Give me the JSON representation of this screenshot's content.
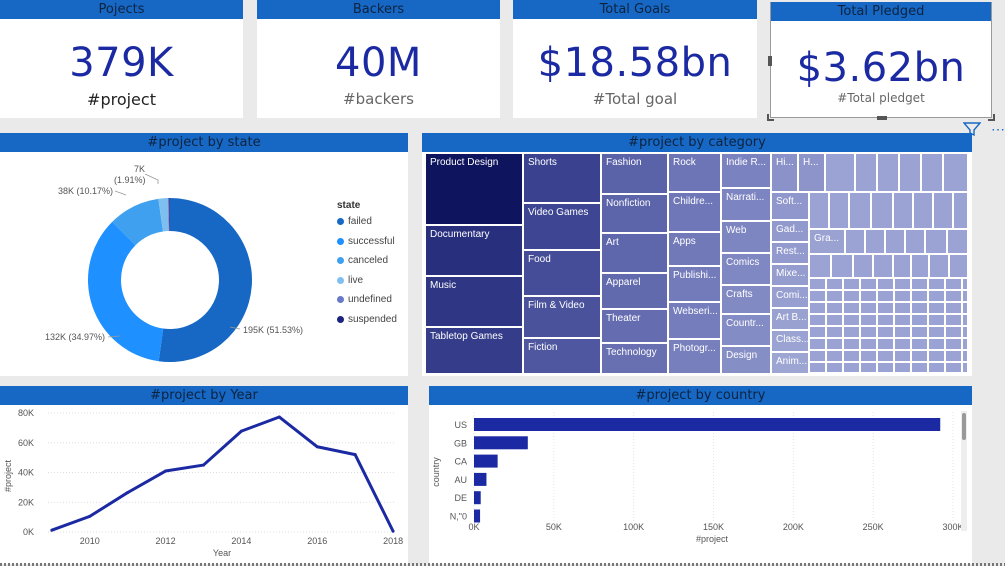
{
  "kpis": [
    {
      "header": "Pojects",
      "value": "379K",
      "sub": "#project"
    },
    {
      "header": "Backers",
      "value": "40M",
      "sub": "#backers"
    },
    {
      "header": "Total Goals",
      "value": "$18.58bn",
      "sub": "#Total goal"
    },
    {
      "header": "Total Pledged",
      "value": "$3.62bn",
      "sub": "#Total pledget"
    }
  ],
  "state_panel": {
    "header": "#project by state",
    "legend_title": "state",
    "labels": {
      "failed": "195K (51.53%)",
      "successful": "132K (34.97%)",
      "canceled": "38K (10.17%)",
      "live_a": "7K",
      "live_b": "(1.91%)"
    },
    "colors": {
      "failed": "#1668c4",
      "successful": "#1e90ff",
      "canceled": "#3fa0f0",
      "live": "#7fbff0",
      "undefined": "#6a78c8",
      "suspended": "#1a237e"
    }
  },
  "category_panel": {
    "header": "#project by category",
    "cells": [
      "Product Design",
      "Documentary",
      "Music",
      "Tabletop Games",
      "Shorts",
      "Video Games",
      "Food",
      "Film & Video",
      "Fiction",
      "Fashion",
      "Nonfiction",
      "Art",
      "Apparel",
      "Theater",
      "Technology",
      "Rock",
      "Childre...",
      "Apps",
      "Publishi...",
      "Webseri...",
      "Photogr...",
      "Indie R...",
      "Narrati...",
      "Web",
      "Comics",
      "Crafts",
      "Countr...",
      "Design",
      "Hi...",
      "H...",
      "Soft...",
      "Gad...",
      "Rest...",
      "Mixe...",
      "Comi...",
      "Art B...",
      "Class...",
      "Anim...",
      "Gra..."
    ]
  },
  "year_panel": {
    "header": "#project by Year"
  },
  "country_panel": {
    "header": "#project by country"
  },
  "chart_data": [
    {
      "type": "pie",
      "title": "#project by state",
      "legend_title": "state",
      "categories": [
        "failed",
        "successful",
        "canceled",
        "live",
        "undefined",
        "suspended"
      ],
      "values": [
        195000,
        132000,
        38000,
        7000,
        1000,
        500
      ],
      "percent": [
        51.53,
        34.97,
        10.17,
        1.91,
        0.3,
        0.12
      ],
      "legend_position": "right"
    },
    {
      "type": "line",
      "title": "#project by Year",
      "xlabel": "Year",
      "ylabel": "#project",
      "x": [
        2009,
        2010,
        2011,
        2012,
        2013,
        2014,
        2015,
        2016,
        2017,
        2018
      ],
      "y": [
        1200,
        10500,
        26500,
        41000,
        45000,
        67800,
        77300,
        57300,
        52000,
        500
      ],
      "xticks": [
        "2010",
        "2012",
        "2014",
        "2016",
        "2018"
      ],
      "yticks": [
        "0K",
        "20K",
        "40K",
        "60K",
        "80K"
      ],
      "ylim": [
        0,
        80000
      ],
      "color": "#1b2aa3"
    },
    {
      "type": "bar",
      "orientation": "horizontal",
      "title": "#project by country",
      "xlabel": "#project",
      "ylabel": "country",
      "categories": [
        "US",
        "GB",
        "CA",
        "AU",
        "DE",
        "N,\"0"
      ],
      "values": [
        292000,
        33700,
        14800,
        7800,
        4200,
        3800
      ],
      "xticks": [
        "0K",
        "50K",
        "100K",
        "150K",
        "200K",
        "250K",
        "300K"
      ],
      "xlim": [
        0,
        305000
      ],
      "color": "#1b2aa3"
    }
  ]
}
